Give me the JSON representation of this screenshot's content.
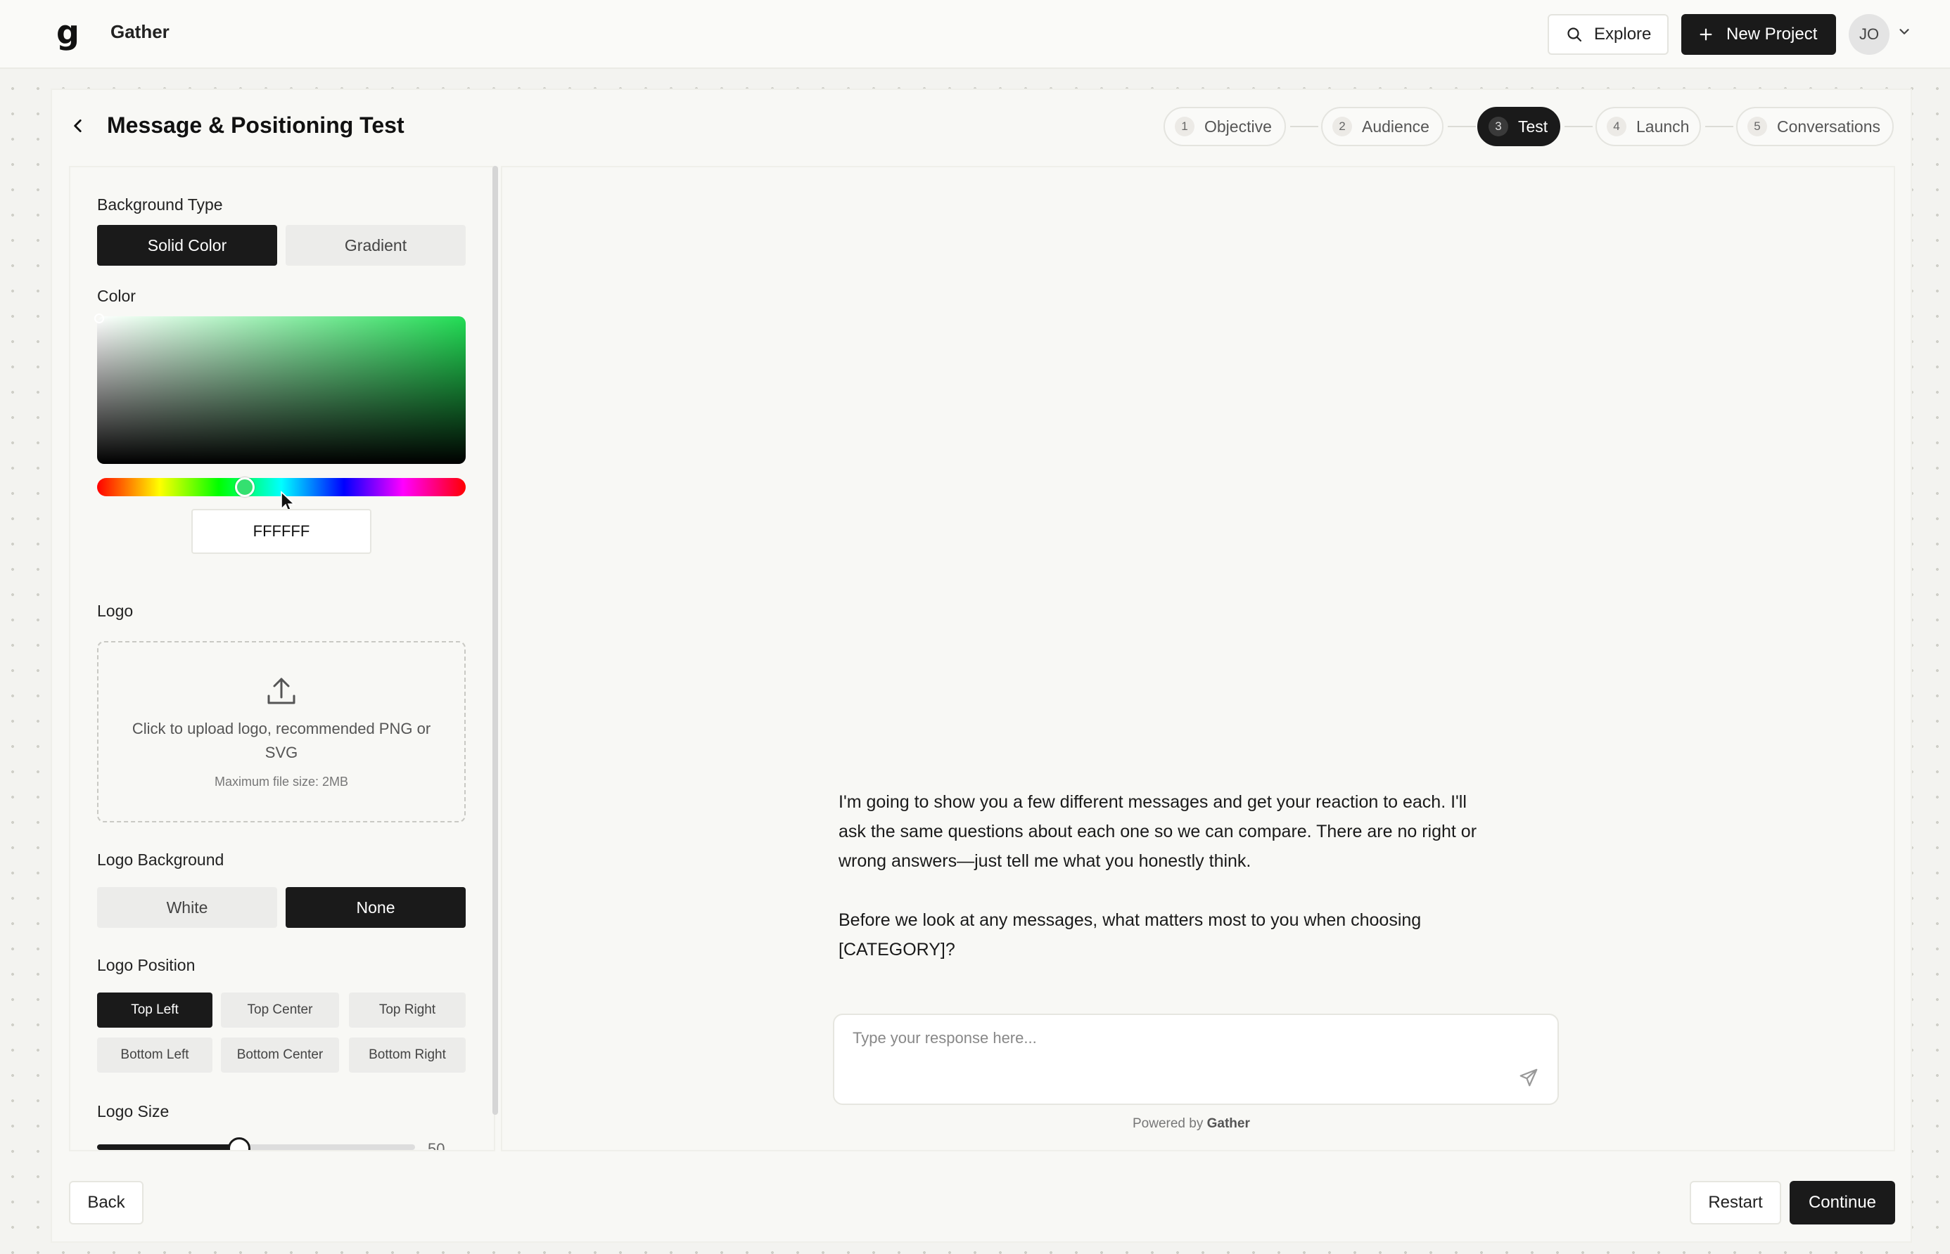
{
  "app": {
    "name": "Gather",
    "logo_glyph": "g"
  },
  "topnav": {
    "explore_label": "Explore",
    "new_project_label": "New Project",
    "avatar_initials": "JO"
  },
  "page": {
    "title": "Message & Positioning Test"
  },
  "steps": [
    {
      "num": "1",
      "label": "Objective",
      "active": false
    },
    {
      "num": "2",
      "label": "Audience",
      "active": false
    },
    {
      "num": "3",
      "label": "Test",
      "active": true
    },
    {
      "num": "4",
      "label": "Launch",
      "active": false
    },
    {
      "num": "5",
      "label": "Conversations",
      "active": false
    }
  ],
  "settings": {
    "background_type": {
      "label": "Background Type",
      "options": [
        "Solid Color",
        "Gradient"
      ],
      "selected": "Solid Color"
    },
    "color": {
      "label": "Color",
      "hex_value": "FFFFFF",
      "hue_color": "#22dd55"
    },
    "logo": {
      "label": "Logo",
      "upload_text": "Click to upload logo, recommended PNG or SVG",
      "upload_sub": "Maximum file size: 2MB"
    },
    "logo_background": {
      "label": "Logo Background",
      "options": [
        "White",
        "None"
      ],
      "selected": "None"
    },
    "logo_position": {
      "label": "Logo Position",
      "options": [
        "Top Left",
        "Top Center",
        "Top Right",
        "Bottom Left",
        "Bottom Center",
        "Bottom Right"
      ],
      "selected": "Top Left"
    },
    "logo_size": {
      "label": "Logo Size",
      "value": "50"
    }
  },
  "preview": {
    "message_p1": "I'm going to show you a few different messages and get your reaction to each. I'll ask the same questions about each one so we can compare. There are no right or wrong answers—just tell me what you honestly think.",
    "message_p2": "Before we look at any messages, what matters most to you when choosing [CATEGORY]?",
    "input_placeholder": "Type your response here...",
    "powered_prefix": "Powered by",
    "powered_brand": "Gather"
  },
  "footer": {
    "back_label": "Back",
    "restart_label": "Restart",
    "continue_label": "Continue"
  }
}
